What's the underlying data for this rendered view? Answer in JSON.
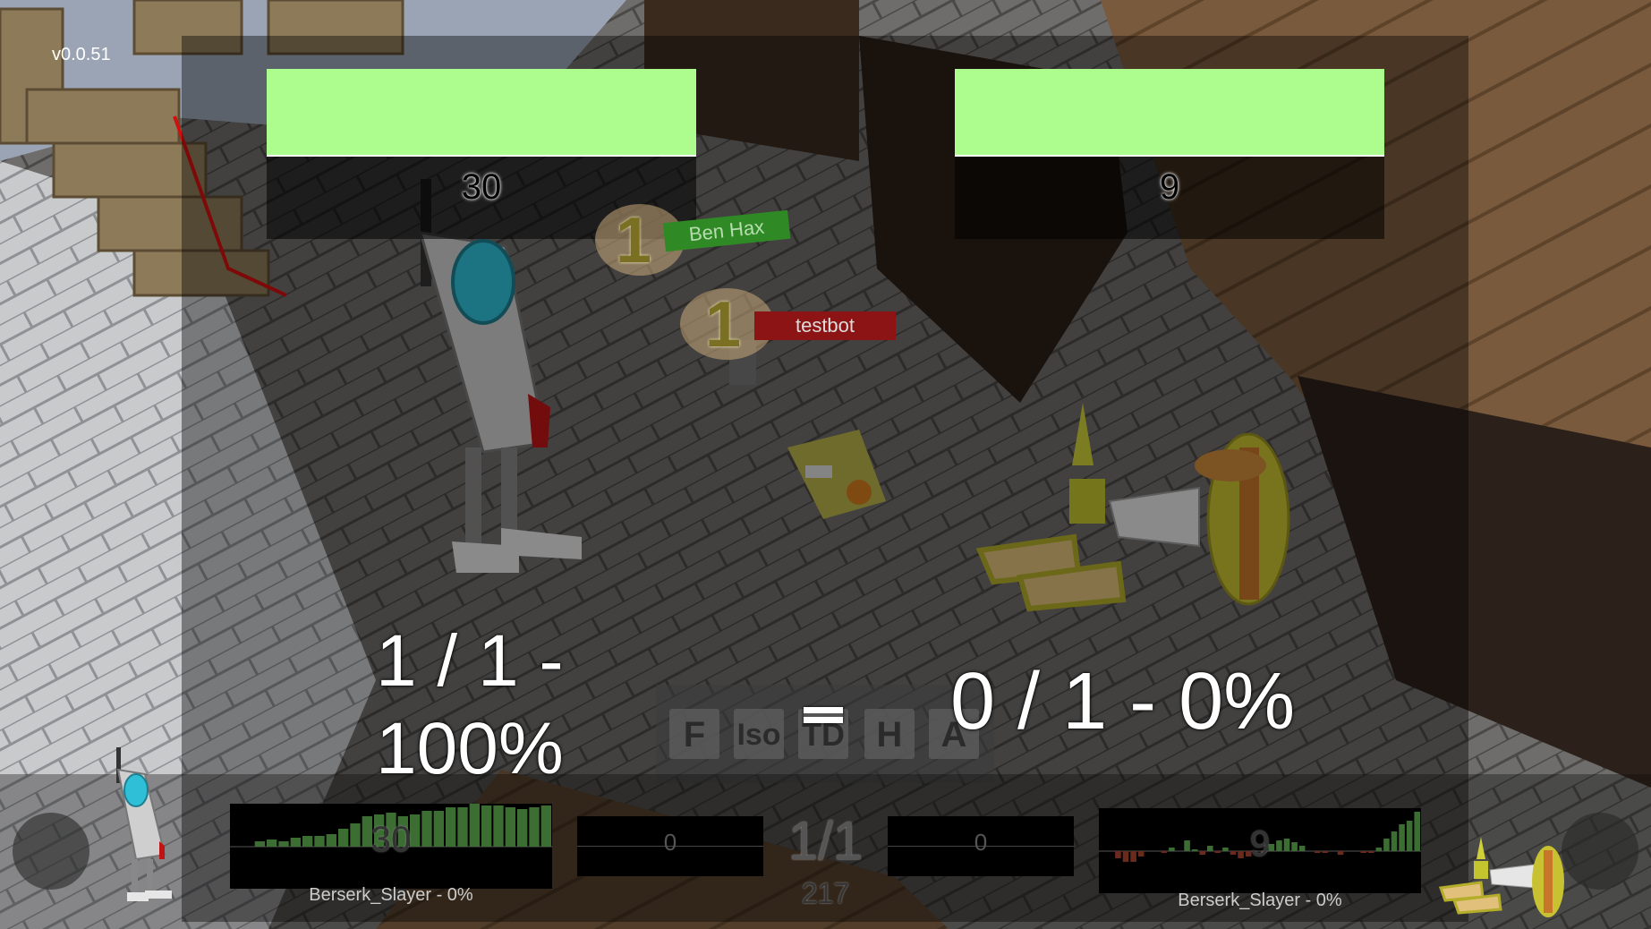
{
  "version": "v0.0.51",
  "left_player": {
    "hp": "30",
    "score_line1": "1 / 1 -",
    "score_line2": "100%",
    "name": "Berserk_Slayer - 0%",
    "graph_value": "30",
    "mid_value": "0",
    "hp_fraction": 1.0
  },
  "right_player": {
    "hp": "9",
    "score": "0 / 1 - 0%",
    "name": "Berserk_Slayer - 0%",
    "graph_value": "9",
    "mid_value": "0",
    "hp_fraction": 1.0
  },
  "center": {
    "round": "1/1",
    "timer": "217"
  },
  "camera_buttons": {
    "f": "F",
    "iso": "Iso",
    "td": "TD",
    "h": "H",
    "a": "A"
  },
  "world_tags": {
    "ben_hax": {
      "level": "1",
      "name": "Ben Hax"
    },
    "testbot": {
      "level": "1",
      "name": "testbot"
    }
  },
  "colors": {
    "hp_bar": "#adfd8e",
    "tag_ally": "#2f8a25",
    "tag_enemy": "#8c1414",
    "graph_positive": "#3c6e34",
    "graph_negative": "#6b2a1e"
  }
}
